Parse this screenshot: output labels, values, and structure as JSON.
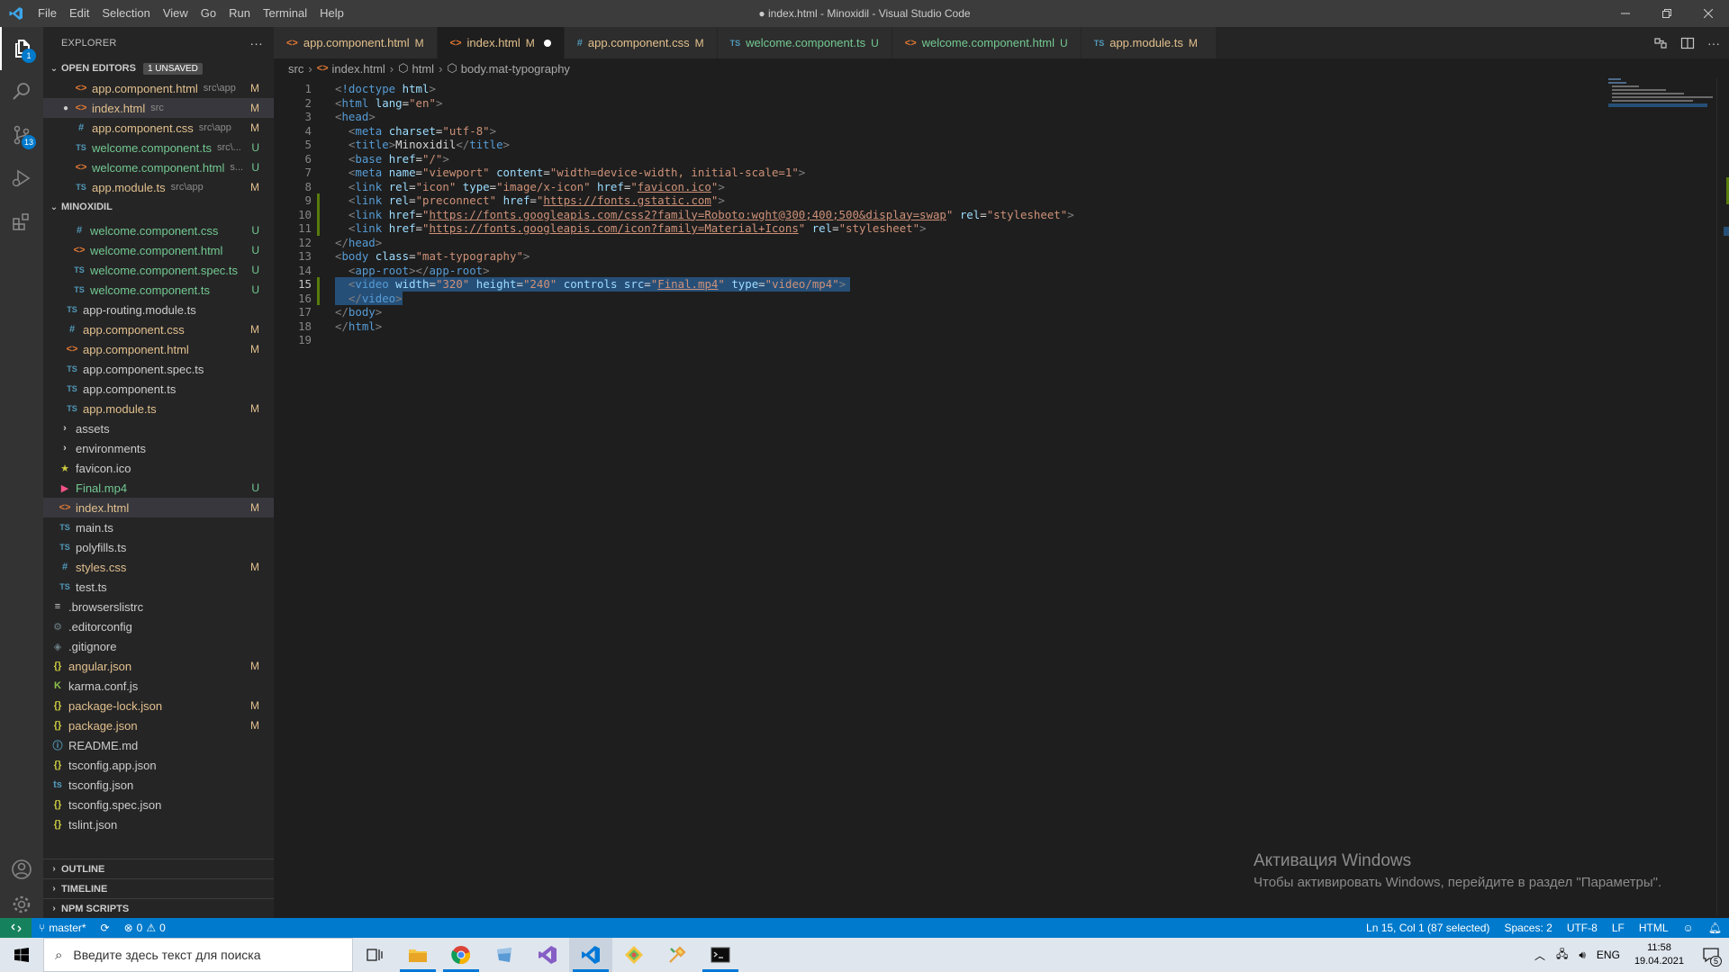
{
  "titlebar": {
    "menu": [
      "File",
      "Edit",
      "Selection",
      "View",
      "Go",
      "Run",
      "Terminal",
      "Help"
    ],
    "title": "● index.html - Minoxidil - Visual Studio Code"
  },
  "activity": {
    "scm_badge": "13",
    "explorer_badge": "1"
  },
  "sidebar": {
    "title": "EXPLORER",
    "more": "···",
    "open_editors_label": "OPEN EDITORS",
    "unsaved_badge": "1 UNSAVED",
    "open_editors": [
      {
        "icon": "<>",
        "icon_class": "i-html",
        "name": "app.component.html",
        "desc": "src\\app",
        "status": "M",
        "status_class": "mod",
        "dot": false
      },
      {
        "icon": "<>",
        "icon_class": "i-html",
        "name": "index.html",
        "desc": "src",
        "status": "M",
        "status_class": "mod",
        "dot": true
      },
      {
        "icon": "#",
        "icon_class": "i-css",
        "name": "app.component.css",
        "desc": "src\\app",
        "status": "M",
        "status_class": "mod",
        "dot": false
      },
      {
        "icon": "TS",
        "icon_class": "i-ts",
        "name": "welcome.component.ts",
        "desc": "src\\...",
        "status": "U",
        "status_class": "unt",
        "dot": false
      },
      {
        "icon": "<>",
        "icon_class": "i-html",
        "name": "welcome.component.html",
        "desc": "s...",
        "status": "U",
        "status_class": "unt",
        "dot": false
      },
      {
        "icon": "TS",
        "icon_class": "i-ts",
        "name": "app.module.ts",
        "desc": "src\\app",
        "status": "M",
        "status_class": "mod",
        "dot": false
      }
    ],
    "project_label": "MINOXIDIL",
    "tree": [
      {
        "indent": 32,
        "icon": "#",
        "icon_class": "i-css",
        "name": "welcome.component.css",
        "status": "U",
        "status_class": "unt"
      },
      {
        "indent": 32,
        "icon": "<>",
        "icon_class": "i-html",
        "name": "welcome.component.html",
        "status": "U",
        "status_class": "unt"
      },
      {
        "indent": 32,
        "icon": "TS",
        "icon_class": "i-ts",
        "name": "welcome.component.spec.ts",
        "status": "U",
        "status_class": "unt"
      },
      {
        "indent": 32,
        "icon": "TS",
        "icon_class": "i-ts",
        "name": "welcome.component.ts",
        "status": "U",
        "status_class": "unt"
      },
      {
        "indent": 24,
        "icon": "TS",
        "icon_class": "i-ts",
        "name": "app-routing.module.ts",
        "status": "",
        "status_class": "plain"
      },
      {
        "indent": 24,
        "icon": "#",
        "icon_class": "i-css",
        "name": "app.component.css",
        "status": "M",
        "status_class": "mod"
      },
      {
        "indent": 24,
        "icon": "<>",
        "icon_class": "i-html",
        "name": "app.component.html",
        "status": "M",
        "status_class": "mod"
      },
      {
        "indent": 24,
        "icon": "TS",
        "icon_class": "i-ts",
        "name": "app.component.spec.ts",
        "status": "",
        "status_class": "plain"
      },
      {
        "indent": 24,
        "icon": "TS",
        "icon_class": "i-ts",
        "name": "app.component.ts",
        "status": "",
        "status_class": "plain"
      },
      {
        "indent": 24,
        "icon": "TS",
        "icon_class": "i-ts",
        "name": "app.module.ts",
        "status": "M",
        "status_class": "mod"
      },
      {
        "indent": 16,
        "icon": "›",
        "icon_class": "plain",
        "name": "assets",
        "status": "",
        "status_class": "plain"
      },
      {
        "indent": 16,
        "icon": "›",
        "icon_class": "plain",
        "name": "environments",
        "status": "",
        "status_class": "plain"
      },
      {
        "indent": 16,
        "icon": "★",
        "icon_class": "i-fav",
        "name": "favicon.ico",
        "status": "",
        "status_class": "plain"
      },
      {
        "indent": 16,
        "icon": "▶",
        "icon_class": "i-mp4",
        "name": "Final.mp4",
        "status": "U",
        "status_class": "unt"
      },
      {
        "indent": 16,
        "icon": "<>",
        "icon_class": "i-html",
        "name": "index.html",
        "status": "M",
        "status_class": "mod",
        "selected": true
      },
      {
        "indent": 16,
        "icon": "TS",
        "icon_class": "i-ts",
        "name": "main.ts",
        "status": "",
        "status_class": "plain"
      },
      {
        "indent": 16,
        "icon": "TS",
        "icon_class": "i-ts",
        "name": "polyfills.ts",
        "status": "",
        "status_class": "plain"
      },
      {
        "indent": 16,
        "icon": "#",
        "icon_class": "i-css",
        "name": "styles.css",
        "status": "M",
        "status_class": "mod"
      },
      {
        "indent": 16,
        "icon": "TS",
        "icon_class": "i-ts",
        "name": "test.ts",
        "status": "",
        "status_class": "plain"
      },
      {
        "indent": 8,
        "icon": "≡",
        "icon_class": "i-browsers",
        "name": ".browserslistrc",
        "status": "",
        "status_class": "plain"
      },
      {
        "indent": 8,
        "icon": "⚙",
        "icon_class": "i-gear",
        "name": ".editorconfig",
        "status": "",
        "status_class": "plain"
      },
      {
        "indent": 8,
        "icon": "◈",
        "icon_class": "i-gear",
        "name": ".gitignore",
        "status": "",
        "status_class": "plain"
      },
      {
        "indent": 8,
        "icon": "{}",
        "icon_class": "i-json",
        "name": "angular.json",
        "status": "M",
        "status_class": "mod"
      },
      {
        "indent": 8,
        "icon": "K",
        "icon_class": "i-karma",
        "name": "karma.conf.js",
        "status": "",
        "status_class": "plain"
      },
      {
        "indent": 8,
        "icon": "{}",
        "icon_class": "i-json",
        "name": "package-lock.json",
        "status": "M",
        "status_class": "mod"
      },
      {
        "indent": 8,
        "icon": "{}",
        "icon_class": "i-json",
        "name": "package.json",
        "status": "M",
        "status_class": "mod"
      },
      {
        "indent": 8,
        "icon": "ⓘ",
        "icon_class": "i-md",
        "name": "README.md",
        "status": "",
        "status_class": "plain"
      },
      {
        "indent": 8,
        "icon": "{}",
        "icon_class": "i-json",
        "name": "tsconfig.app.json",
        "status": "",
        "status_class": "plain"
      },
      {
        "indent": 8,
        "icon": "ts",
        "icon_class": "i-md",
        "name": "tsconfig.json",
        "status": "",
        "status_class": "plain"
      },
      {
        "indent": 8,
        "icon": "{}",
        "icon_class": "i-json",
        "name": "tsconfig.spec.json",
        "status": "",
        "status_class": "plain"
      },
      {
        "indent": 8,
        "icon": "{}",
        "icon_class": "i-json",
        "name": "tslint.json",
        "status": "",
        "status_class": "plain"
      }
    ],
    "bottom_sections": [
      "OUTLINE",
      "TIMELINE",
      "NPM SCRIPTS"
    ]
  },
  "tabs": [
    {
      "icon": "<>",
      "icon_class": "i-html",
      "name": "app.component.html",
      "status": "M",
      "status_class": "mod",
      "active": false
    },
    {
      "icon": "<>",
      "icon_class": "i-html",
      "name": "index.html",
      "status": "M",
      "status_class": "mod",
      "active": true,
      "dirty": true
    },
    {
      "icon": "#",
      "icon_class": "i-css",
      "name": "app.component.css",
      "status": "M",
      "status_class": "mod",
      "active": false
    },
    {
      "icon": "TS",
      "icon_class": "i-ts",
      "name": "welcome.component.ts",
      "status": "U",
      "status_class": "unt",
      "active": false
    },
    {
      "icon": "<>",
      "icon_class": "i-html",
      "name": "welcome.component.html",
      "status": "U",
      "status_class": "unt",
      "active": false
    },
    {
      "icon": "TS",
      "icon_class": "i-ts",
      "name": "app.module.ts",
      "status": "M",
      "status_class": "mod",
      "active": false
    }
  ],
  "breadcrumb": [
    "src",
    "index.html",
    "html",
    "body.mat-typography"
  ],
  "code": [
    [
      [
        "pn",
        "<"
      ],
      [
        "tg",
        "!doctype"
      ],
      [
        "tx",
        " "
      ],
      [
        "at",
        "html"
      ],
      [
        "pn",
        ">"
      ]
    ],
    [
      [
        "pn",
        "<"
      ],
      [
        "tg",
        "html"
      ],
      [
        "tx",
        " "
      ],
      [
        "at",
        "lang"
      ],
      [
        "tx",
        "="
      ],
      [
        "sv",
        "\"en\""
      ],
      [
        "pn",
        ">"
      ]
    ],
    [
      [
        "pn",
        "<"
      ],
      [
        "tg",
        "head"
      ],
      [
        "pn",
        ">"
      ]
    ],
    [
      [
        "tx",
        "  "
      ],
      [
        "pn",
        "<"
      ],
      [
        "tg",
        "meta"
      ],
      [
        "tx",
        " "
      ],
      [
        "at",
        "charset"
      ],
      [
        "tx",
        "="
      ],
      [
        "sv",
        "\"utf-8\""
      ],
      [
        "pn",
        ">"
      ]
    ],
    [
      [
        "tx",
        "  "
      ],
      [
        "pn",
        "<"
      ],
      [
        "tg",
        "title"
      ],
      [
        "pn",
        ">"
      ],
      [
        "tx",
        "Minoxidil"
      ],
      [
        "pn",
        "</"
      ],
      [
        "tg",
        "title"
      ],
      [
        "pn",
        ">"
      ]
    ],
    [
      [
        "tx",
        "  "
      ],
      [
        "pn",
        "<"
      ],
      [
        "tg",
        "base"
      ],
      [
        "tx",
        " "
      ],
      [
        "at",
        "href"
      ],
      [
        "tx",
        "="
      ],
      [
        "sv",
        "\"/\""
      ],
      [
        "pn",
        ">"
      ]
    ],
    [
      [
        "tx",
        "  "
      ],
      [
        "pn",
        "<"
      ],
      [
        "tg",
        "meta"
      ],
      [
        "tx",
        " "
      ],
      [
        "at",
        "name"
      ],
      [
        "tx",
        "="
      ],
      [
        "sv",
        "\"viewport\""
      ],
      [
        "tx",
        " "
      ],
      [
        "at",
        "content"
      ],
      [
        "tx",
        "="
      ],
      [
        "sv",
        "\"width=device-width, initial-scale=1\""
      ],
      [
        "pn",
        ">"
      ]
    ],
    [
      [
        "tx",
        "  "
      ],
      [
        "pn",
        "<"
      ],
      [
        "tg",
        "link"
      ],
      [
        "tx",
        " "
      ],
      [
        "at",
        "rel"
      ],
      [
        "tx",
        "="
      ],
      [
        "sv",
        "\"icon\""
      ],
      [
        "tx",
        " "
      ],
      [
        "at",
        "type"
      ],
      [
        "tx",
        "="
      ],
      [
        "sv",
        "\"image/x-icon\""
      ],
      [
        "tx",
        " "
      ],
      [
        "at",
        "href"
      ],
      [
        "tx",
        "="
      ],
      [
        "sv",
        "\""
      ],
      [
        "lk",
        "favicon.ico"
      ],
      [
        "sv",
        "\""
      ],
      [
        "pn",
        ">"
      ]
    ],
    [
      [
        "tx",
        "  "
      ],
      [
        "pn",
        "<"
      ],
      [
        "tg",
        "link"
      ],
      [
        "tx",
        " "
      ],
      [
        "at",
        "rel"
      ],
      [
        "tx",
        "="
      ],
      [
        "sv",
        "\"preconnect\""
      ],
      [
        "tx",
        " "
      ],
      [
        "at",
        "href"
      ],
      [
        "tx",
        "="
      ],
      [
        "sv",
        "\""
      ],
      [
        "lk",
        "https://fonts.gstatic.com"
      ],
      [
        "sv",
        "\""
      ],
      [
        "pn",
        ">"
      ]
    ],
    [
      [
        "tx",
        "  "
      ],
      [
        "pn",
        "<"
      ],
      [
        "tg",
        "link"
      ],
      [
        "tx",
        " "
      ],
      [
        "at",
        "href"
      ],
      [
        "tx",
        "="
      ],
      [
        "sv",
        "\""
      ],
      [
        "lk",
        "https://fonts.googleapis.com/css2?family=Roboto:wght@300;400;500&display=swap"
      ],
      [
        "sv",
        "\""
      ],
      [
        "tx",
        " "
      ],
      [
        "at",
        "rel"
      ],
      [
        "tx",
        "="
      ],
      [
        "sv",
        "\"stylesheet\""
      ],
      [
        "pn",
        ">"
      ]
    ],
    [
      [
        "tx",
        "  "
      ],
      [
        "pn",
        "<"
      ],
      [
        "tg",
        "link"
      ],
      [
        "tx",
        " "
      ],
      [
        "at",
        "href"
      ],
      [
        "tx",
        "="
      ],
      [
        "sv",
        "\""
      ],
      [
        "lk",
        "https://fonts.googleapis.com/icon?family=Material+Icons"
      ],
      [
        "sv",
        "\""
      ],
      [
        "tx",
        " "
      ],
      [
        "at",
        "rel"
      ],
      [
        "tx",
        "="
      ],
      [
        "sv",
        "\"stylesheet\""
      ],
      [
        "pn",
        ">"
      ]
    ],
    [
      [
        "pn",
        "</"
      ],
      [
        "tg",
        "head"
      ],
      [
        "pn",
        ">"
      ]
    ],
    [
      [
        "pn",
        "<"
      ],
      [
        "tg",
        "body"
      ],
      [
        "tx",
        " "
      ],
      [
        "at",
        "class"
      ],
      [
        "tx",
        "="
      ],
      [
        "sv",
        "\"mat-typography\""
      ],
      [
        "pn",
        ">"
      ]
    ],
    [
      [
        "tx",
        "  "
      ],
      [
        "pn",
        "<"
      ],
      [
        "tg",
        "app-root"
      ],
      [
        "pn",
        "></"
      ],
      [
        "tg",
        "app-root"
      ],
      [
        "pn",
        ">"
      ]
    ],
    [
      [
        "tx",
        "  "
      ],
      [
        "pn",
        "<"
      ],
      [
        "tg",
        "video"
      ],
      [
        "tx",
        " "
      ],
      [
        "at",
        "width"
      ],
      [
        "tx",
        "="
      ],
      [
        "sv",
        "\"320\""
      ],
      [
        "tx",
        " "
      ],
      [
        "at",
        "height"
      ],
      [
        "tx",
        "="
      ],
      [
        "sv",
        "\"240\""
      ],
      [
        "tx",
        " "
      ],
      [
        "at",
        "controls"
      ],
      [
        "tx",
        " "
      ],
      [
        "at",
        "src"
      ],
      [
        "tx",
        "="
      ],
      [
        "sv",
        "\""
      ],
      [
        "lk",
        "Final.mp4"
      ],
      [
        "sv",
        "\""
      ],
      [
        "tx",
        " "
      ],
      [
        "at",
        "type"
      ],
      [
        "tx",
        "="
      ],
      [
        "sv",
        "\"video/mp4\""
      ],
      [
        "pn",
        ">"
      ]
    ],
    [
      [
        "tx",
        "  "
      ],
      [
        "pn",
        "</"
      ],
      [
        "tg",
        "video"
      ],
      [
        "pn",
        ">"
      ]
    ],
    [
      [
        "pn",
        "</"
      ],
      [
        "tg",
        "body"
      ],
      [
        "pn",
        ">"
      ]
    ],
    [
      [
        "pn",
        "</"
      ],
      [
        "tg",
        "html"
      ],
      [
        "pn",
        ">"
      ]
    ],
    []
  ],
  "current_line": 15,
  "activation": {
    "line1": "Активация Windows",
    "line2": "Чтобы активировать Windows, перейдите в раздел \"Параметры\"."
  },
  "statusbar": {
    "branch": "master*",
    "errors": "0",
    "warnings": "0",
    "position": "Ln 15, Col 1 (87 selected)",
    "spaces": "Spaces: 2",
    "encoding": "UTF-8",
    "eol": "LF",
    "language": "HTML"
  },
  "taskbar": {
    "search_placeholder": "Введите здесь текст для поиска",
    "lang": "ENG",
    "time": "11:58",
    "date": "19.04.2021",
    "notif_count": "5"
  }
}
